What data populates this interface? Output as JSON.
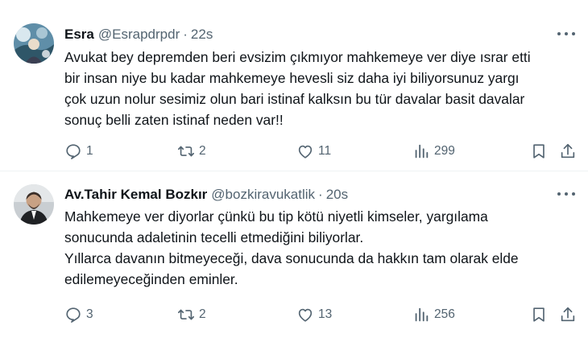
{
  "tweets": [
    {
      "name": "Esra",
      "handle": "@Esrapdrpdr",
      "separator": "·",
      "time": "22s",
      "lines": [
        "Avukat bey depremden beri evsizim çıkmıyor mahkemeye ver diye ısrar etti",
        "bir insan niye bu kadar mahkemeye hevesli siz daha iyi biliyorsunuz yargı",
        "çok uzun nolur sesimiz olun bari istinaf kalksın bu tür davalar basit davalar",
        "sonuç belli zaten istinaf neden var!!"
      ],
      "replies": "1",
      "reposts": "2",
      "likes": "11",
      "views": "299"
    },
    {
      "name": "Av.Tahir Kemal Bozkır",
      "handle": "@bozkiravukatlik",
      "separator": "·",
      "time": "20s",
      "lines": [
        "Mahkemeye ver diyorlar çünkü bu tip kötü niyetli kimseler, yargılama",
        "sonucunda adaletinin tecelli etmediğini biliyorlar.",
        "Yıllarca davanın bitmeyeceği, dava sonucunda da hakkın tam olarak elde",
        "edilemeyeceğinden eminler."
      ],
      "replies": "3",
      "reposts": "2",
      "likes": "13",
      "views": "256"
    }
  ],
  "icons": {
    "reply": "reply-icon",
    "repost": "repost-icon",
    "like": "heart-icon",
    "views": "views-chart-icon",
    "bookmark": "bookmark-icon",
    "share": "share-icon",
    "more": "more-dots-icon"
  },
  "colors": {
    "text": "#0f1419",
    "secondary": "#536471",
    "divider": "#eff3f4"
  }
}
